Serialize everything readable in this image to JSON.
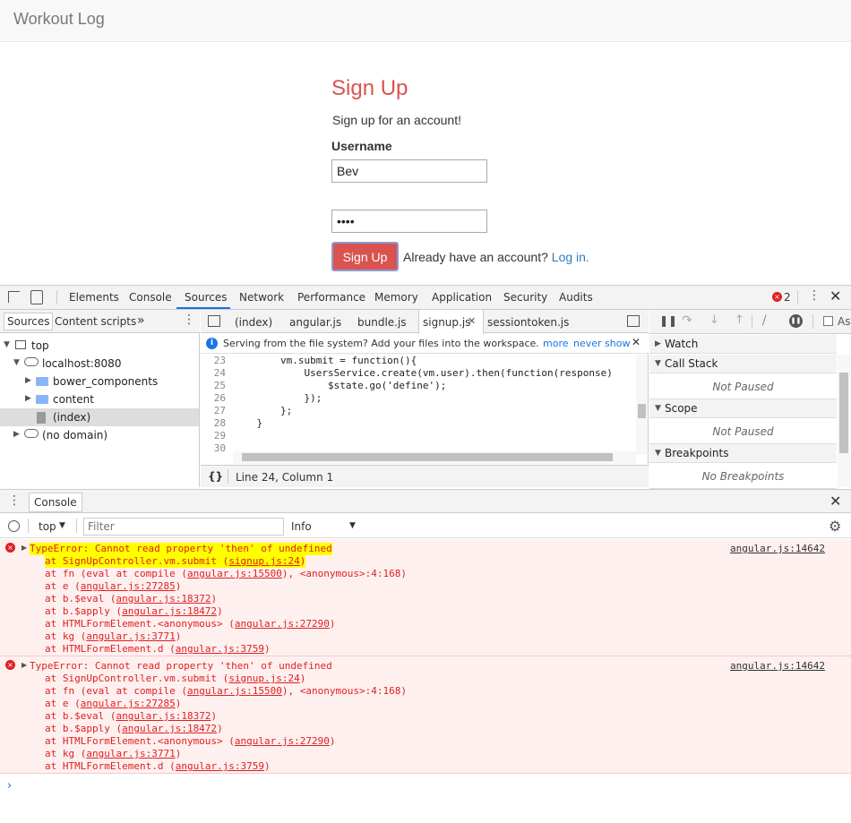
{
  "app": {
    "brand": "Workout Log"
  },
  "signup": {
    "title": "Sign Up",
    "subtitle": "Sign up for an account!",
    "username_label": "Username",
    "username_value": "Bev",
    "password_value": "••••",
    "button_label": "Sign Up",
    "already_text": "Already have an account?",
    "login_link": "Log in."
  },
  "devtools": {
    "tabs": [
      "Elements",
      "Console",
      "Sources",
      "Network",
      "Performance",
      "Memory",
      "Application",
      "Security",
      "Audits"
    ],
    "active_tab": "Sources",
    "error_count": "2",
    "navigator": {
      "tabs": [
        "Sources",
        "Content scripts",
        "»"
      ],
      "tree": [
        {
          "label": "top"
        },
        {
          "label": "localhost:8080"
        },
        {
          "label": "bower_components"
        },
        {
          "label": "content"
        },
        {
          "label": "(index)"
        },
        {
          "label": "(no domain)"
        }
      ]
    },
    "editor": {
      "tabs": [
        "(index)",
        "angular.js",
        "bundle.js",
        "signup.js",
        "sessiontoken.js"
      ],
      "active_tab": "signup.js",
      "info": "Serving from the file system? Add your files into the workspace.",
      "info_more": "more",
      "info_never": "never show",
      "lines": [
        {
          "n": "23",
          "code": "        vm.submit = function(){"
        },
        {
          "n": "24",
          "code": "            UsersService.create(vm.user).then(function(response)"
        },
        {
          "n": "25",
          "code": "                $state.go('define');"
        },
        {
          "n": "26",
          "code": "            });"
        },
        {
          "n": "27",
          "code": "        };"
        },
        {
          "n": "28",
          "code": "    }"
        },
        {
          "n": "29",
          "code": ""
        },
        {
          "n": "30",
          "code": ""
        }
      ],
      "status": "Line 24, Column 1",
      "braces": "{}"
    },
    "debugger": {
      "sections": [
        {
          "title": "Watch"
        },
        {
          "title": "Call Stack",
          "body": "Not Paused"
        },
        {
          "title": "Scope",
          "body": "Not Paused"
        },
        {
          "title": "Breakpoints",
          "body": "No Breakpoints"
        }
      ],
      "async_label": "As"
    },
    "console": {
      "drawer_tab": "Console",
      "context": "top",
      "filter_placeholder": "Filter",
      "level": "Info",
      "errors": [
        {
          "message": "TypeError: Cannot read property 'then' of undefined",
          "source": "angular.js:14642",
          "stack": [
            {
              "pre": "at SignUpController.vm.submit (",
              "link": "signup.js:24",
              "post": ")"
            },
            {
              "pre": "at fn (eval at compile (",
              "link": "angular.js:15500",
              "post": "), <anonymous>:4:168)"
            },
            {
              "pre": "at e (",
              "link": "angular.js:27285",
              "post": ")"
            },
            {
              "pre": "at b.$eval (",
              "link": "angular.js:18372",
              "post": ")"
            },
            {
              "pre": "at b.$apply (",
              "link": "angular.js:18472",
              "post": ")"
            },
            {
              "pre": "at HTMLFormElement.<anonymous> (",
              "link": "angular.js:27290",
              "post": ")"
            },
            {
              "pre": "at kg (",
              "link": "angular.js:3771",
              "post": ")"
            },
            {
              "pre": "at HTMLFormElement.d (",
              "link": "angular.js:3759",
              "post": ")"
            }
          ]
        },
        {
          "message": "TypeError: Cannot read property 'then' of undefined",
          "source": "angular.js:14642",
          "stack": [
            {
              "pre": "at SignUpController.vm.submit (",
              "link": "signup.js:24",
              "post": ")"
            },
            {
              "pre": "at fn (eval at compile (",
              "link": "angular.js:15500",
              "post": "), <anonymous>:4:168)"
            },
            {
              "pre": "at e (",
              "link": "angular.js:27285",
              "post": ")"
            },
            {
              "pre": "at b.$eval (",
              "link": "angular.js:18372",
              "post": ")"
            },
            {
              "pre": "at b.$apply (",
              "link": "angular.js:18472",
              "post": ")"
            },
            {
              "pre": "at HTMLFormElement.<anonymous> (",
              "link": "angular.js:27290",
              "post": ")"
            },
            {
              "pre": "at kg (",
              "link": "angular.js:3771",
              "post": ")"
            },
            {
              "pre": "at HTMLFormElement.d (",
              "link": "angular.js:3759",
              "post": ")"
            }
          ]
        }
      ],
      "prompt": "›"
    }
  },
  "colors": {
    "brand_red": "#d9534f",
    "link_blue": "#337ab7",
    "error_red": "#e02020",
    "error_bg": "#fff0f0",
    "highlight": "#ffff00"
  }
}
